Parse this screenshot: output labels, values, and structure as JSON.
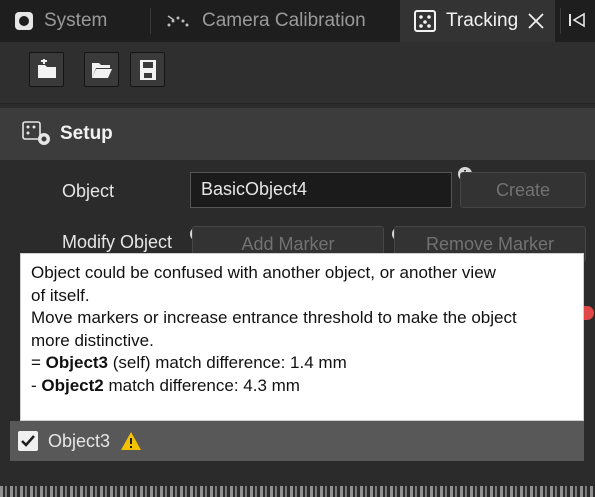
{
  "tabs": [
    {
      "label": "System",
      "icon": "system-icon",
      "active": false
    },
    {
      "label": "Camera Calibration",
      "icon": "camera-calibration-icon",
      "active": false
    },
    {
      "label": "Tracking",
      "icon": "tracking-icon",
      "active": true
    }
  ],
  "toolbar": {
    "buttons": [
      {
        "icon": "add-file-icon"
      },
      {
        "icon": "open-folder-icon"
      },
      {
        "icon": "save-icon"
      }
    ]
  },
  "setup": {
    "title": "Setup",
    "object_label": "Object",
    "object_value": "BasicObject4",
    "create_label": "Create",
    "modify_label": "Modify Object",
    "add_marker_label": "Add Marker",
    "remove_marker_label": "Remove Marker"
  },
  "tooltip": {
    "line1": "Object could be confused with another object, or another view",
    "line2": "of itself.",
    "line3": "Move markers or increase entrance threshold to make the object",
    "line4": "more distinctive.",
    "match1_prefix": "= ",
    "match1_name": "Object3",
    "match1_rest": " (self) match difference: 1.4 mm",
    "match2_prefix": "- ",
    "match2_name": "Object2",
    "match2_rest": " match difference: 4.3 mm"
  },
  "list": {
    "row_label": "Object3",
    "checked": true
  },
  "colors": {
    "warning": "#f2c200",
    "status_dot": "#e04848"
  }
}
